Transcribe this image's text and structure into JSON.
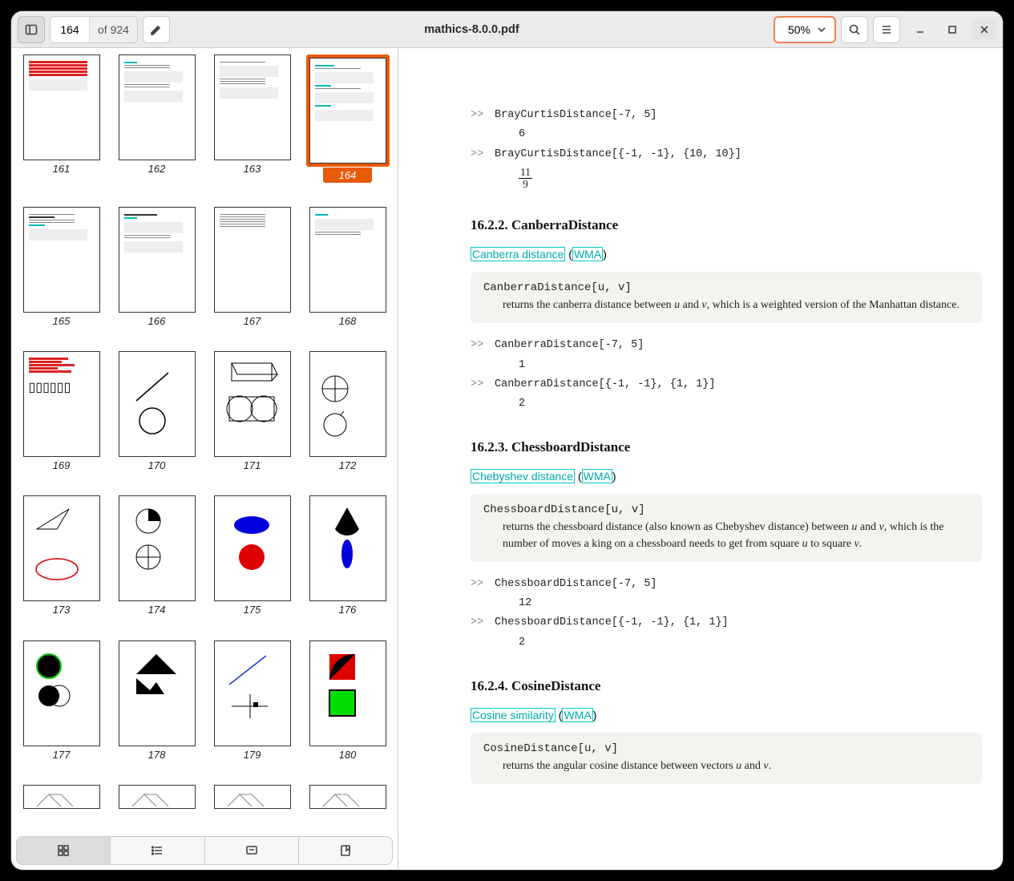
{
  "header": {
    "title": "mathics-8.0.0.pdf",
    "current_page": "164",
    "total_pages_label": "of 924",
    "zoom": "50%"
  },
  "thumbnails": {
    "start": 161,
    "end": 180,
    "selected": 164
  },
  "doc": {
    "ex1_in": "BrayCurtisDistance[-7, 5]",
    "ex1_out": "6",
    "ex2_in": "BrayCurtisDistance[{-1, -1}, {10, 10}]",
    "ex2_num": "11",
    "ex2_den": "9",
    "s2_heading": "16.2.2.  CanberraDistance",
    "s2_link1": "Canberra distance",
    "s2_link2": "WMA",
    "s2_sig": "CanberraDistance[u, v]",
    "s2_desc_a": "returns the canberra distance between ",
    "s2_desc_b": " and ",
    "s2_desc_c": ", which is a weighted version of the Manhattan distance.",
    "s2_ex1_in": "CanberraDistance[-7, 5]",
    "s2_ex1_out": "1",
    "s2_ex2_in": "CanberraDistance[{-1, -1}, {1, 1}]",
    "s2_ex2_out": "2",
    "s3_heading": "16.2.3.  ChessboardDistance",
    "s3_link1": "Chebyshev distance",
    "s3_link2": "WMA",
    "s3_sig": "ChessboardDistance[u, v]",
    "s3_desc_a": "returns the chessboard distance (also known as Chebyshev distance) between ",
    "s3_desc_b": " and ",
    "s3_desc_c": ", which is the number of moves a king on a chessboard needs to get from square ",
    "s3_desc_d": " to square ",
    "s3_desc_e": ".",
    "s3_ex1_in": "ChessboardDistance[-7, 5]",
    "s3_ex1_out": "12",
    "s3_ex2_in": "ChessboardDistance[{-1, -1}, {1, 1}]",
    "s3_ex2_out": "2",
    "s4_heading": "16.2.4.  CosineDistance",
    "s4_link1": "Cosine similarity",
    "s4_link2": "WMA",
    "s4_sig": "CosineDistance[u, v]",
    "s4_desc_a": "returns the angular cosine distance between vectors ",
    "s4_desc_b": " and ",
    "s4_desc_c": "."
  },
  "prompt": ">>"
}
